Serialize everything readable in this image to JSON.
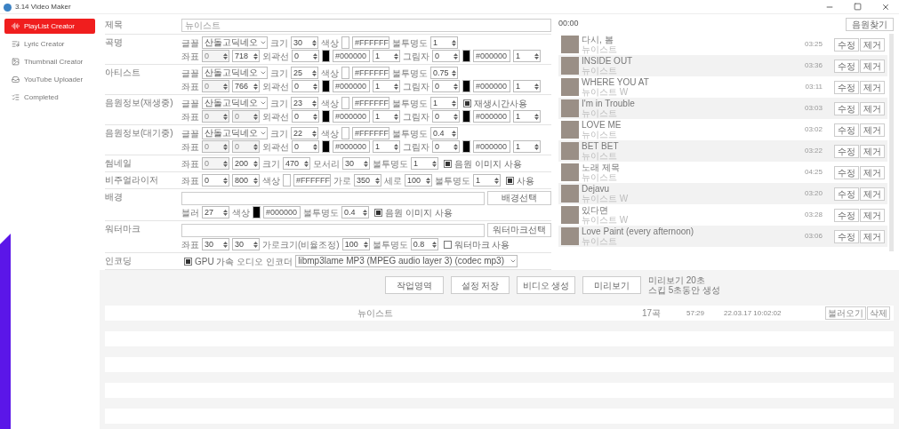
{
  "window": {
    "title": "3.14 Video Maker"
  },
  "sidebar": {
    "items": [
      {
        "label": "PlayList Creator",
        "selected": true
      },
      {
        "label": "Lyric Creator",
        "selected": false
      },
      {
        "label": "Thumbnail Creator",
        "selected": false
      },
      {
        "label": "YouTube Uploader",
        "selected": false
      },
      {
        "label": "Completed",
        "selected": false
      }
    ]
  },
  "settings": [
    {
      "label": "제목",
      "lines": [
        [
          {
            "kind": "input",
            "placeholder": "뉴이스트"
          }
        ]
      ]
    },
    {
      "label": "곡명",
      "lines": [
        [
          {
            "kind": "label",
            "text": "글꼴"
          },
          {
            "kind": "select",
            "value": "산돌고딕네오"
          },
          {
            "kind": "label",
            "text": "크기"
          },
          {
            "kind": "spin",
            "value": "30",
            "disabled": false
          },
          {
            "kind": "label",
            "text": "색상"
          },
          {
            "kind": "color",
            "color": "#ffffff"
          },
          {
            "kind": "text",
            "value": "#FFFFFF"
          },
          {
            "kind": "label",
            "text": "불투명도"
          },
          {
            "kind": "spin",
            "value": "1",
            "disabled": false
          }
        ],
        [
          {
            "kind": "label",
            "text": "좌표"
          },
          {
            "kind": "spin",
            "value": "0",
            "disabled": true
          },
          {
            "kind": "spin",
            "value": "718",
            "disabled": false
          },
          {
            "kind": "label",
            "text": "외곽선"
          },
          {
            "kind": "spin",
            "value": "0",
            "disabled": false
          },
          {
            "kind": "color",
            "color": "#000000"
          },
          {
            "kind": "text",
            "value": "#000000"
          },
          {
            "kind": "spin",
            "value": "1",
            "disabled": false
          },
          {
            "kind": "label",
            "text": "그림자"
          },
          {
            "kind": "spin",
            "value": "0",
            "disabled": false
          },
          {
            "kind": "color",
            "color": "#000000"
          },
          {
            "kind": "text",
            "value": "#000000"
          },
          {
            "kind": "spin",
            "value": "1",
            "disabled": false
          }
        ]
      ]
    },
    {
      "label": "아티스트",
      "lines": [
        [
          {
            "kind": "label",
            "text": "글꼴"
          },
          {
            "kind": "select",
            "value": "산돌고딕네오"
          },
          {
            "kind": "label",
            "text": "크기"
          },
          {
            "kind": "spin",
            "value": "25",
            "disabled": false
          },
          {
            "kind": "label",
            "text": "색상"
          },
          {
            "kind": "color",
            "color": "#ffffff"
          },
          {
            "kind": "text",
            "value": "#FFFFFF"
          },
          {
            "kind": "label",
            "text": "불투명도"
          },
          {
            "kind": "spin",
            "value": "0.75",
            "disabled": false
          }
        ],
        [
          {
            "kind": "label",
            "text": "좌표"
          },
          {
            "kind": "spin",
            "value": "0",
            "disabled": true
          },
          {
            "kind": "spin",
            "value": "766",
            "disabled": false
          },
          {
            "kind": "label",
            "text": "외곽선"
          },
          {
            "kind": "spin",
            "value": "0",
            "disabled": false
          },
          {
            "kind": "color",
            "color": "#000000"
          },
          {
            "kind": "text",
            "value": "#000000"
          },
          {
            "kind": "spin",
            "value": "1",
            "disabled": false
          },
          {
            "kind": "label",
            "text": "그림자"
          },
          {
            "kind": "spin",
            "value": "0",
            "disabled": false
          },
          {
            "kind": "color",
            "color": "#000000"
          },
          {
            "kind": "text",
            "value": "#000000"
          },
          {
            "kind": "spin",
            "value": "1",
            "disabled": false
          }
        ]
      ]
    },
    {
      "label": "음원정보(재생중)",
      "lines": [
        [
          {
            "kind": "label",
            "text": "글꼴"
          },
          {
            "kind": "select",
            "value": "산돌고딕네오"
          },
          {
            "kind": "label",
            "text": "크기"
          },
          {
            "kind": "spin",
            "value": "23",
            "disabled": false
          },
          {
            "kind": "label",
            "text": "색상"
          },
          {
            "kind": "color",
            "color": "#ffffff"
          },
          {
            "kind": "text",
            "value": "#FFFFFF"
          },
          {
            "kind": "label",
            "text": "불투명도"
          },
          {
            "kind": "spin",
            "value": "1",
            "disabled": false
          },
          {
            "kind": "checkbox",
            "text": "재생시간사용",
            "checked": true
          }
        ],
        [
          {
            "kind": "label",
            "text": "좌표"
          },
          {
            "kind": "spin",
            "value": "0",
            "disabled": true
          },
          {
            "kind": "spin",
            "value": "0",
            "disabled": true
          },
          {
            "kind": "label",
            "text": "외곽선"
          },
          {
            "kind": "spin",
            "value": "0",
            "disabled": false
          },
          {
            "kind": "color",
            "color": "#000000"
          },
          {
            "kind": "text",
            "value": "#000000"
          },
          {
            "kind": "spin",
            "value": "1",
            "disabled": false
          },
          {
            "kind": "label",
            "text": "그림자"
          },
          {
            "kind": "spin",
            "value": "0",
            "disabled": false
          },
          {
            "kind": "color",
            "color": "#000000"
          },
          {
            "kind": "text",
            "value": "#000000"
          },
          {
            "kind": "spin",
            "value": "1",
            "disabled": false
          }
        ]
      ]
    },
    {
      "label": "음원정보(대기중)",
      "lines": [
        [
          {
            "kind": "label",
            "text": "글꼴"
          },
          {
            "kind": "select",
            "value": "산돌고딕네오"
          },
          {
            "kind": "label",
            "text": "크기"
          },
          {
            "kind": "spin",
            "value": "22",
            "disabled": false
          },
          {
            "kind": "label",
            "text": "색상"
          },
          {
            "kind": "color",
            "color": "#ffffff"
          },
          {
            "kind": "text",
            "value": "#FFFFFF"
          },
          {
            "kind": "label",
            "text": "불투명도"
          },
          {
            "kind": "spin",
            "value": "0.4",
            "disabled": false
          }
        ],
        [
          {
            "kind": "label",
            "text": "좌표"
          },
          {
            "kind": "spin",
            "value": "0",
            "disabled": true
          },
          {
            "kind": "spin",
            "value": "0",
            "disabled": true
          },
          {
            "kind": "label",
            "text": "외곽선"
          },
          {
            "kind": "spin",
            "value": "0",
            "disabled": false
          },
          {
            "kind": "color",
            "color": "#000000"
          },
          {
            "kind": "text",
            "value": "#000000"
          },
          {
            "kind": "spin",
            "value": "1",
            "disabled": false
          },
          {
            "kind": "label",
            "text": "그림자"
          },
          {
            "kind": "spin",
            "value": "0",
            "disabled": false
          },
          {
            "kind": "color",
            "color": "#000000"
          },
          {
            "kind": "text",
            "value": "#000000"
          },
          {
            "kind": "spin",
            "value": "1",
            "disabled": false
          }
        ]
      ]
    },
    {
      "label": "썸네일",
      "lines": [
        [
          {
            "kind": "label",
            "text": "좌표"
          },
          {
            "kind": "spin",
            "value": "0",
            "disabled": true
          },
          {
            "kind": "spin",
            "value": "200",
            "disabled": false
          },
          {
            "kind": "label",
            "text": "크기"
          },
          {
            "kind": "spin",
            "value": "470",
            "disabled": false
          },
          {
            "kind": "label",
            "text": "모서리"
          },
          {
            "kind": "spin",
            "value": "30",
            "disabled": false
          },
          {
            "kind": "label",
            "text": "불투명도"
          },
          {
            "kind": "spin",
            "value": "1",
            "disabled": false
          },
          {
            "kind": "checkbox",
            "text": "음원 이미지 사용",
            "checked": true
          }
        ]
      ]
    },
    {
      "label": "비주얼라이저",
      "lines": [
        [
          {
            "kind": "label",
            "text": "좌표"
          },
          {
            "kind": "spin",
            "value": "0",
            "disabled": false
          },
          {
            "kind": "spin",
            "value": "800",
            "disabled": false
          },
          {
            "kind": "label",
            "text": "색상"
          },
          {
            "kind": "color",
            "color": "#ffffff"
          },
          {
            "kind": "text",
            "value": "#FFFFFF"
          },
          {
            "kind": "label",
            "text": "가로"
          },
          {
            "kind": "spin",
            "value": "350",
            "disabled": false
          },
          {
            "kind": "label",
            "text": "세로"
          },
          {
            "kind": "spin",
            "value": "100",
            "disabled": false
          },
          {
            "kind": "label",
            "text": "불투명도"
          },
          {
            "kind": "spin",
            "value": "1",
            "disabled": false
          },
          {
            "kind": "checkbox",
            "text": "사용",
            "checked": true
          }
        ]
      ]
    },
    {
      "label": "배경",
      "lines": [
        [
          {
            "kind": "input"
          },
          {
            "kind": "button",
            "text": "배경선택"
          }
        ],
        [
          {
            "kind": "label",
            "text": "블러"
          },
          {
            "kind": "spin",
            "value": "27",
            "disabled": false
          },
          {
            "kind": "label",
            "text": "색상"
          },
          {
            "kind": "color",
            "color": "#000000"
          },
          {
            "kind": "text",
            "value": "#000000"
          },
          {
            "kind": "label",
            "text": "불투명도"
          },
          {
            "kind": "spin",
            "value": "0.4",
            "disabled": false
          },
          {
            "kind": "checkbox",
            "text": "음원 이미지 사용",
            "checked": true
          }
        ]
      ]
    },
    {
      "label": "워터마크",
      "lines": [
        [
          {
            "kind": "input"
          },
          {
            "kind": "button",
            "text": "워터마크선택"
          }
        ],
        [
          {
            "kind": "label",
            "text": "좌표"
          },
          {
            "kind": "spin",
            "value": "30",
            "disabled": false
          },
          {
            "kind": "spin",
            "value": "30",
            "disabled": false
          },
          {
            "kind": "label",
            "text": "가로크기(비율조정)"
          },
          {
            "kind": "spin",
            "value": "100",
            "disabled": false
          },
          {
            "kind": "label",
            "text": "불투명도"
          },
          {
            "kind": "spin",
            "value": "0.8",
            "disabled": false
          },
          {
            "kind": "checkbox",
            "text": "워터마크 사용",
            "checked": false
          }
        ]
      ]
    },
    {
      "label": "인코딩",
      "lines": [
        [
          {
            "kind": "checkbox",
            "text": "GPU 가속",
            "checked": true
          },
          {
            "kind": "label",
            "text": "오디오 인코더"
          },
          {
            "kind": "wide-select",
            "value": "libmp3lame MP3 (MPEG audio layer 3) (codec mp3)"
          }
        ]
      ]
    }
  ],
  "player": {
    "time": "00:00",
    "find_button": "음원찾기"
  },
  "playlist": [
    {
      "title": "다시, 봄",
      "artist": "뉴이스트",
      "duration": "03:25",
      "edit": "수정",
      "remove": "제거"
    },
    {
      "title": "INSIDE OUT",
      "artist": "뉴이스트",
      "duration": "03:36",
      "edit": "수정",
      "remove": "제거"
    },
    {
      "title": "WHERE YOU AT",
      "artist": "뉴이스트 W",
      "duration": "03:11",
      "edit": "수정",
      "remove": "제거"
    },
    {
      "title": "I'm in Trouble",
      "artist": "뉴이스트",
      "duration": "03:03",
      "edit": "수정",
      "remove": "제거"
    },
    {
      "title": "LOVE ME",
      "artist": "뉴이스트",
      "duration": "03:02",
      "edit": "수정",
      "remove": "제거"
    },
    {
      "title": "BET BET",
      "artist": "뉴이스트",
      "duration": "03:22",
      "edit": "수정",
      "remove": "제거"
    },
    {
      "title": "노래 제목",
      "artist": "뉴이스트",
      "duration": "04:25",
      "edit": "수정",
      "remove": "제거"
    },
    {
      "title": "Dejavu",
      "artist": "뉴이스트 W",
      "duration": "03:20",
      "edit": "수정",
      "remove": "제거"
    },
    {
      "title": "있다면",
      "artist": "뉴이스트 W",
      "duration": "03:28",
      "edit": "수정",
      "remove": "제거"
    },
    {
      "title": "Love Paint (every afternoon)",
      "artist": "뉴이스트",
      "duration": "03:06",
      "edit": "수정",
      "remove": "제거"
    }
  ],
  "actions": [
    "작업영역",
    "설정 저장",
    "비디오 생성",
    "미리보기"
  ],
  "preview_note": [
    "미리보기 20초",
    "스킵 5초동안 생성"
  ],
  "saved": [
    {
      "name": "뉴이스트",
      "count": "17곡",
      "length": "57:29",
      "date": "22.03.17 10:02:02",
      "load": "불러오기",
      "delete": "삭제"
    }
  ]
}
